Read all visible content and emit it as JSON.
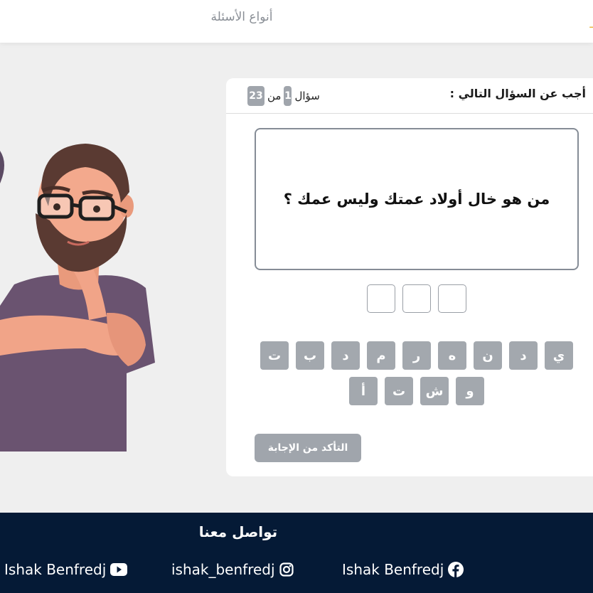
{
  "nav": {
    "question_types": "أنواع الأسئلة",
    "brand_fragment": "ـ"
  },
  "quiz": {
    "prompt": "أجب عن السؤال التالي :",
    "counter_word": "سؤال",
    "current": "1",
    "of_word": "من",
    "total": "23",
    "question": "من هو خال أولاد عمتك وليس عمك ؟",
    "answer_slots": 3,
    "keys_row1": [
      "ي",
      "د",
      "ن",
      "ه",
      "ر",
      "م",
      "د",
      "ب",
      "ت"
    ],
    "keys_row2": [
      "و",
      "ش",
      "ت",
      "أ"
    ],
    "check_button": "التأكد من الإجابة"
  },
  "footer": {
    "title": "تواصل معنا",
    "facebook": "Ishak Benfredj",
    "instagram": "ishak_benfredj",
    "youtube": "Ishak Benfredj"
  },
  "icons": {
    "facebook": "facebook-icon",
    "instagram": "instagram-icon",
    "youtube": "youtube-icon"
  },
  "colors": {
    "footer_bg": "#051a36",
    "key_bg": "#a3a8ae",
    "badge_bg": "#a0a5ac",
    "page_bg": "#efefef"
  }
}
